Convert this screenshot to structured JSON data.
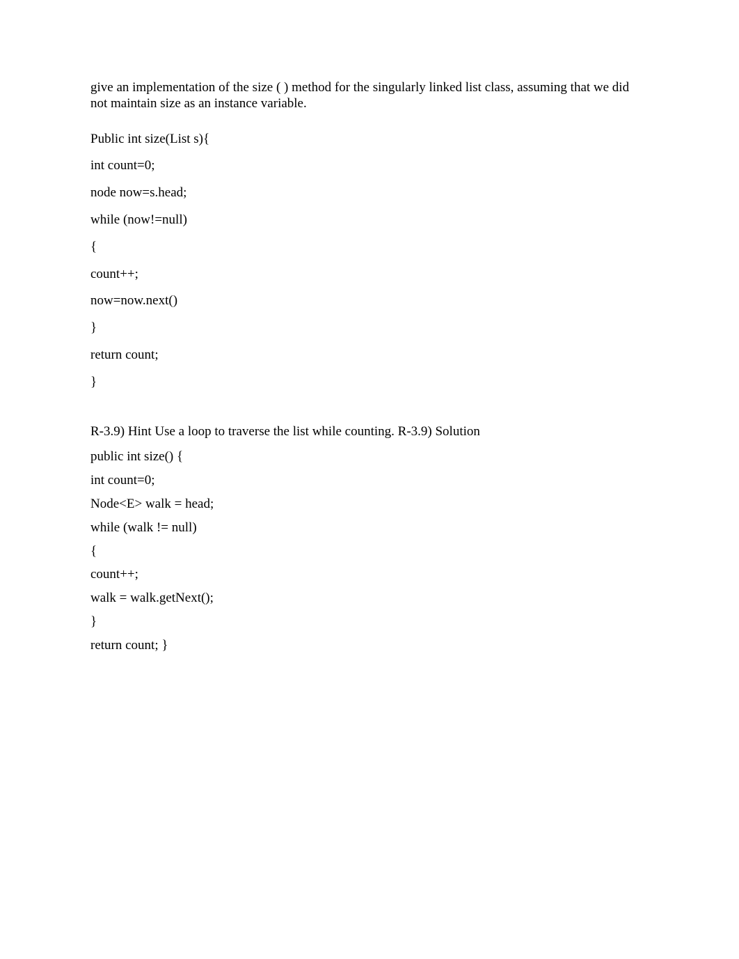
{
  "intro": "give an implementation of the size ( ) method for the singularly linked list class, assuming that we did not maintain size as an instance variable.",
  "code1": {
    "l1": "Public int size(List s){",
    "l2": "int count=0;",
    "l3": "node now=s.head;",
    "l4": "while (now!=null)",
    "l5": "{",
    "l6": "count++;",
    "l7": "now=now.next()",
    "l8": "}",
    "l9": "return count;",
    "l10": "}"
  },
  "hint": "R-3.9) Hint Use a loop to traverse the list while counting. R-3.9) Solution",
  "code2": {
    "l1": "public int size() {",
    "l2": "int count=0;",
    "l3": "Node<E> walk = head;",
    "l4": "while (walk != null)",
    "l5": "{",
    "l6": "count++;",
    "l7": "walk = walk.getNext();",
    "l8": "}",
    "l9": "return count; }"
  }
}
